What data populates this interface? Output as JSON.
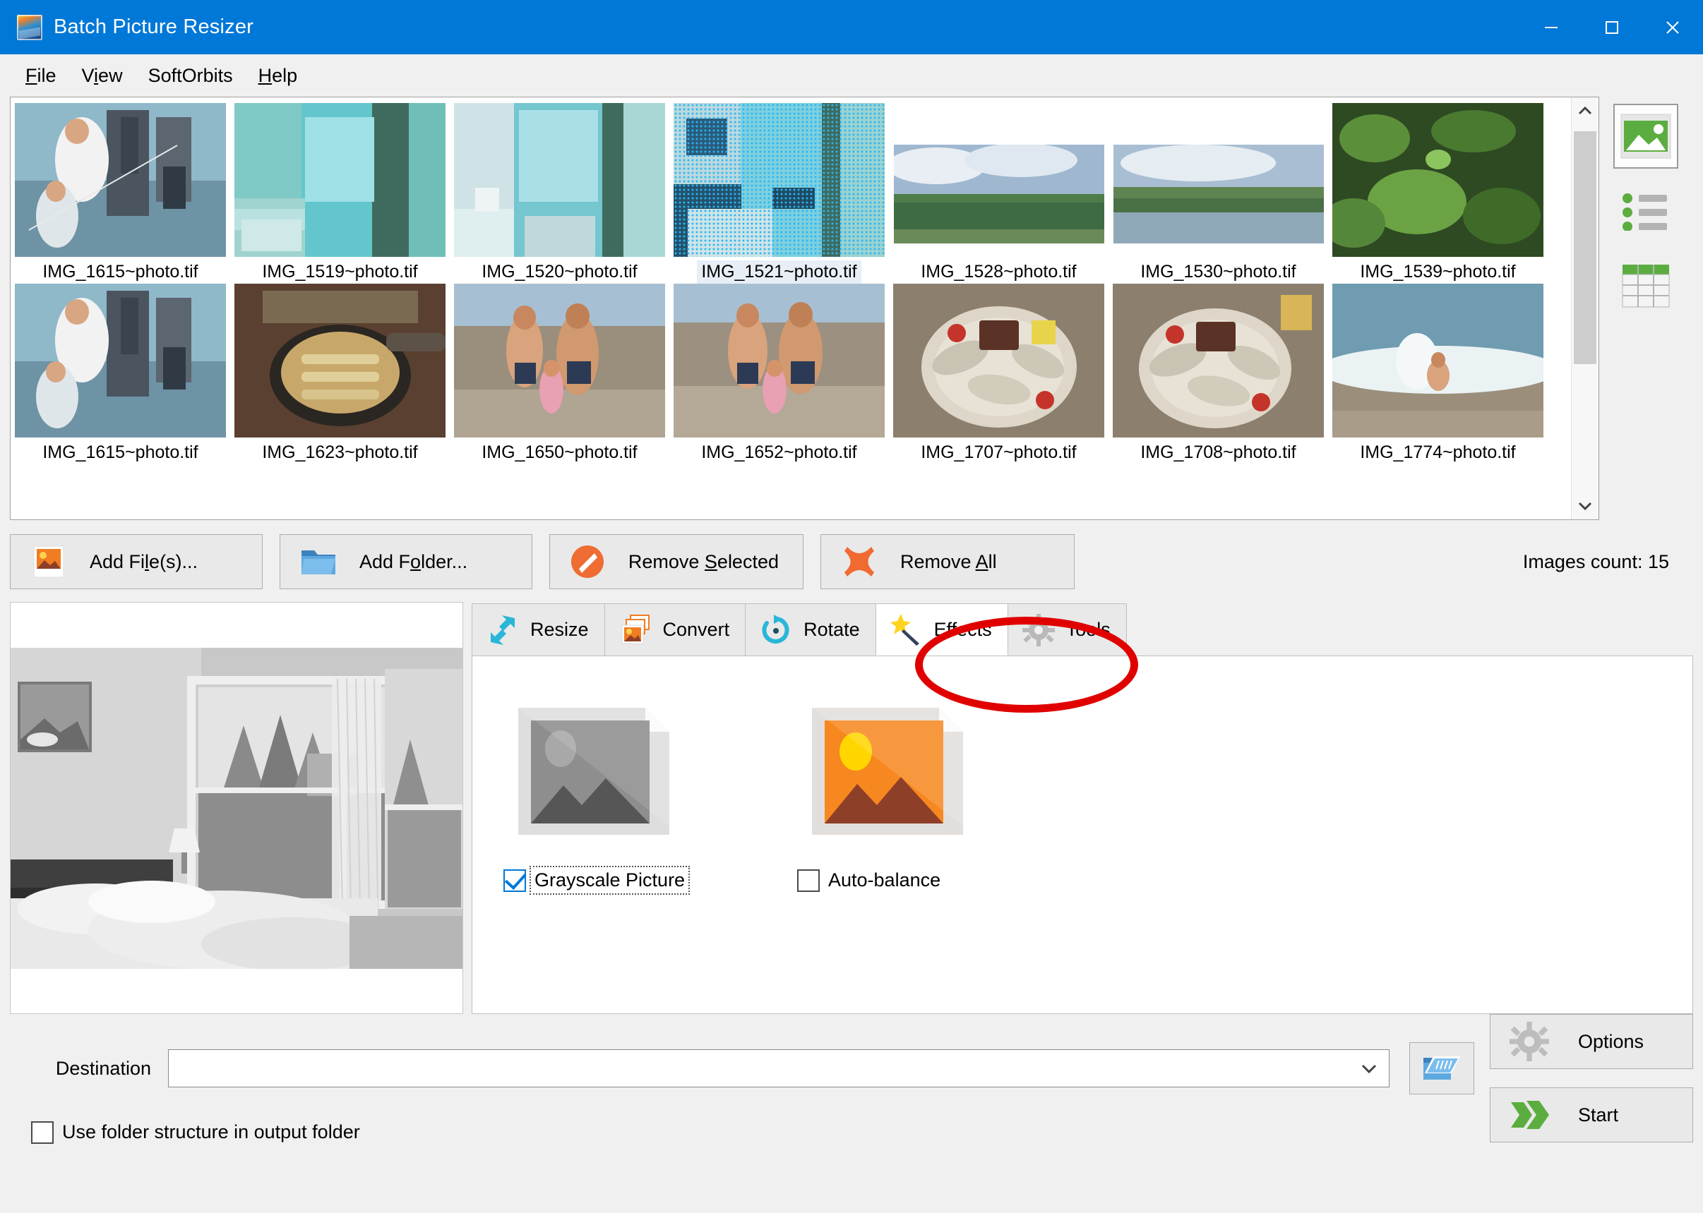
{
  "window": {
    "title": "Batch Picture Resizer",
    "icon": "app-logo-icon",
    "controls": {
      "minimize": "—",
      "maximize": "□",
      "close": "✕"
    }
  },
  "menu": {
    "items": [
      {
        "label": "File",
        "accel": "F"
      },
      {
        "label": "View",
        "accel": "V"
      },
      {
        "label": "SoftOrbits",
        "accel": ""
      },
      {
        "label": "Help",
        "accel": "H"
      }
    ]
  },
  "thumbnails": {
    "rows": [
      [
        {
          "name": "IMG_1615~photo.tif",
          "selected": false,
          "kind": "fishing"
        },
        {
          "name": "IMG_1519~photo.tif",
          "selected": false,
          "kind": "room-teal"
        },
        {
          "name": "IMG_1520~photo.tif",
          "selected": false,
          "kind": "room-window"
        },
        {
          "name": "IMG_1521~photo.tif",
          "selected": true,
          "kind": "room-bed"
        },
        {
          "name": "IMG_1528~photo.tif",
          "selected": false,
          "kind": "landscape-sky"
        },
        {
          "name": "IMG_1530~photo.tif",
          "selected": false,
          "kind": "landscape-lake"
        },
        {
          "name": "IMG_1539~photo.tif",
          "selected": false,
          "kind": "leaves"
        }
      ],
      [
        {
          "name": "IMG_1615~photo.tif",
          "selected": false,
          "kind": "fishing"
        },
        {
          "name": "IMG_1623~photo.tif",
          "selected": false,
          "kind": "cooking-pan"
        },
        {
          "name": "IMG_1650~photo.tif",
          "selected": false,
          "kind": "beach-family"
        },
        {
          "name": "IMG_1652~photo.tif",
          "selected": false,
          "kind": "beach-family"
        },
        {
          "name": "IMG_1707~photo.tif",
          "selected": false,
          "kind": "food-plate"
        },
        {
          "name": "IMG_1708~photo.tif",
          "selected": false,
          "kind": "food-plate"
        },
        {
          "name": "IMG_1774~photo.tif",
          "selected": false,
          "kind": "sea-child"
        }
      ]
    ],
    "scrollbar": {
      "up": "scroll-up-arrow",
      "down": "scroll-down-arrow"
    }
  },
  "view_modes": [
    {
      "name": "thumbnail-view",
      "active": true
    },
    {
      "name": "list-view",
      "active": false
    },
    {
      "name": "table-view",
      "active": false
    }
  ],
  "actions": {
    "add_files": {
      "label": "Add File(s)...",
      "accel": "l",
      "icon": "picture-icon"
    },
    "add_folder": {
      "label": "Add Folder...",
      "accel": "o",
      "icon": "folder-icon"
    },
    "remove_selected": {
      "label": "Remove Selected",
      "accel": "S",
      "icon": "no-entry-icon"
    },
    "remove_all": {
      "label": "Remove All",
      "accel": "A",
      "icon": "cross-icon"
    },
    "images_count": "Images count: 15"
  },
  "tabs": [
    {
      "label": "Resize",
      "icon": "resize-arrows-icon",
      "active": false
    },
    {
      "label": "Convert",
      "icon": "convert-images-icon",
      "active": false
    },
    {
      "label": "Rotate",
      "icon": "rotate-icon",
      "active": false
    },
    {
      "label": "Effects",
      "icon": "magic-wand-icon",
      "active": true
    },
    {
      "label": "Tools",
      "icon": "gear-icon",
      "active": false
    }
  ],
  "effects": [
    {
      "label": "Grayscale Picture",
      "checked": true,
      "focused": true,
      "icon": "grayscale-photo-icon"
    },
    {
      "label": "Auto-balance",
      "checked": false,
      "focused": false,
      "icon": "color-photo-icon"
    }
  ],
  "destination": {
    "label": "Destination",
    "value": "",
    "placeholder": "",
    "chevron": "chevron-down-icon",
    "browse_icon": "open-folder-icon"
  },
  "use_folder_structure": {
    "label": "Use folder structure in output folder",
    "checked": false
  },
  "footer_buttons": {
    "options": {
      "label": "Options",
      "icon": "gear-icon"
    },
    "start": {
      "label": "Start",
      "icon": "green-arrow-icon"
    }
  },
  "annotation": {
    "type": "red-ellipse-highlight",
    "target": "tab-effects",
    "color": "#e00000"
  },
  "colors": {
    "titlebar": "#0078d7",
    "window_bg": "#f0f0f0",
    "accent_green": "#5bad3f",
    "accent_orange": "#e8742c",
    "annotation_red": "#e00000"
  }
}
